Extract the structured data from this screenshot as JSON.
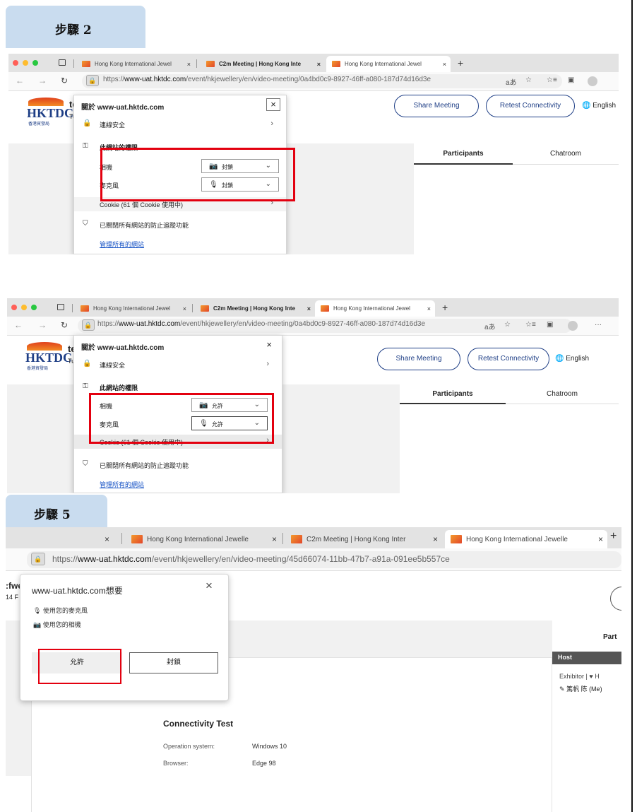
{
  "steps": {
    "step2_label": "步驟 2",
    "step5_label": "步驟 5"
  },
  "browser": {
    "tabs": [
      "Hong Kong International Jewel",
      "C2m Meeting | Hong Kong Inte",
      "Hong Kong International Jewel"
    ],
    "tab_close": "×",
    "new_tab": "+",
    "url_scheme": "https://",
    "url_host": "www-uat.hktdc.com",
    "url_path": "/event/hkjewellery/en/video-meeting/0a4bd0c9-8927-46ff-a080-187d74d16d3e",
    "reading_mode": "aあ"
  },
  "site": {
    "logo_text": "HKTDC",
    "logo_sub": "香港貿發局",
    "title_fragment": "te",
    "subtitle_fragment": "Tu",
    "share_button": "Share Meeting",
    "retest_button": "Retest Connectivity",
    "language": "English",
    "participants_tab": "Participants",
    "chatroom_tab": "Chatroom"
  },
  "site_info_popup": {
    "title": "關於 www-uat.hktdc.com",
    "close": "×",
    "connection_secure": "連線安全",
    "permissions_heading": "此網站的權限",
    "camera_label": "相機",
    "mic_label": "麥克風",
    "cookie_text": "Cookie (61 個 Cookie 使用中)",
    "tracking_text": "已關閉所有網站的防止追蹤功能",
    "manage_link": "管理所有的網站"
  },
  "shot1": {
    "camera_value": "封鎖",
    "mic_value": "封鎖"
  },
  "shot2": {
    "camera_value": "允許",
    "mic_value": "允許"
  },
  "shot3": {
    "tabs": [
      "Hong Kong International Jewelle",
      "C2m Meeting | Hong Kong Inter",
      "Hong Kong International Jewelle"
    ],
    "url_scheme": "https://",
    "url_host": "www-uat.hktdc.com",
    "url_path": "/event/hkjewellery/en/video-meeting/45d66074-11bb-47b7-a91a-091ee5b557ce",
    "left_fragment_1": ":fwe",
    "left_fragment_2": "14 F",
    "prompt_title": "www-uat.hktdc.com想要",
    "prompt_mic": "使用您的麥克風",
    "prompt_camera": "使用您的相機",
    "allow_button": "允許",
    "block_button": "封鎖",
    "right_tab_fragment": "Part",
    "host_label": "Host",
    "exhibitor_line": "Exhibitor | ♥ H",
    "user_line": "篤帆 陈 (Me)",
    "connectivity_title": "Connectivity Test",
    "os_label": "Operation system:",
    "os_value": "Windows 10",
    "browser_label": "Browser:",
    "browser_value": "Edge 98"
  },
  "colors": {
    "step_tab_bg": "#c9dcef",
    "highlight_red": "#e3000f",
    "brand_blue": "#1f3f86",
    "link_blue": "#1a55c6"
  }
}
